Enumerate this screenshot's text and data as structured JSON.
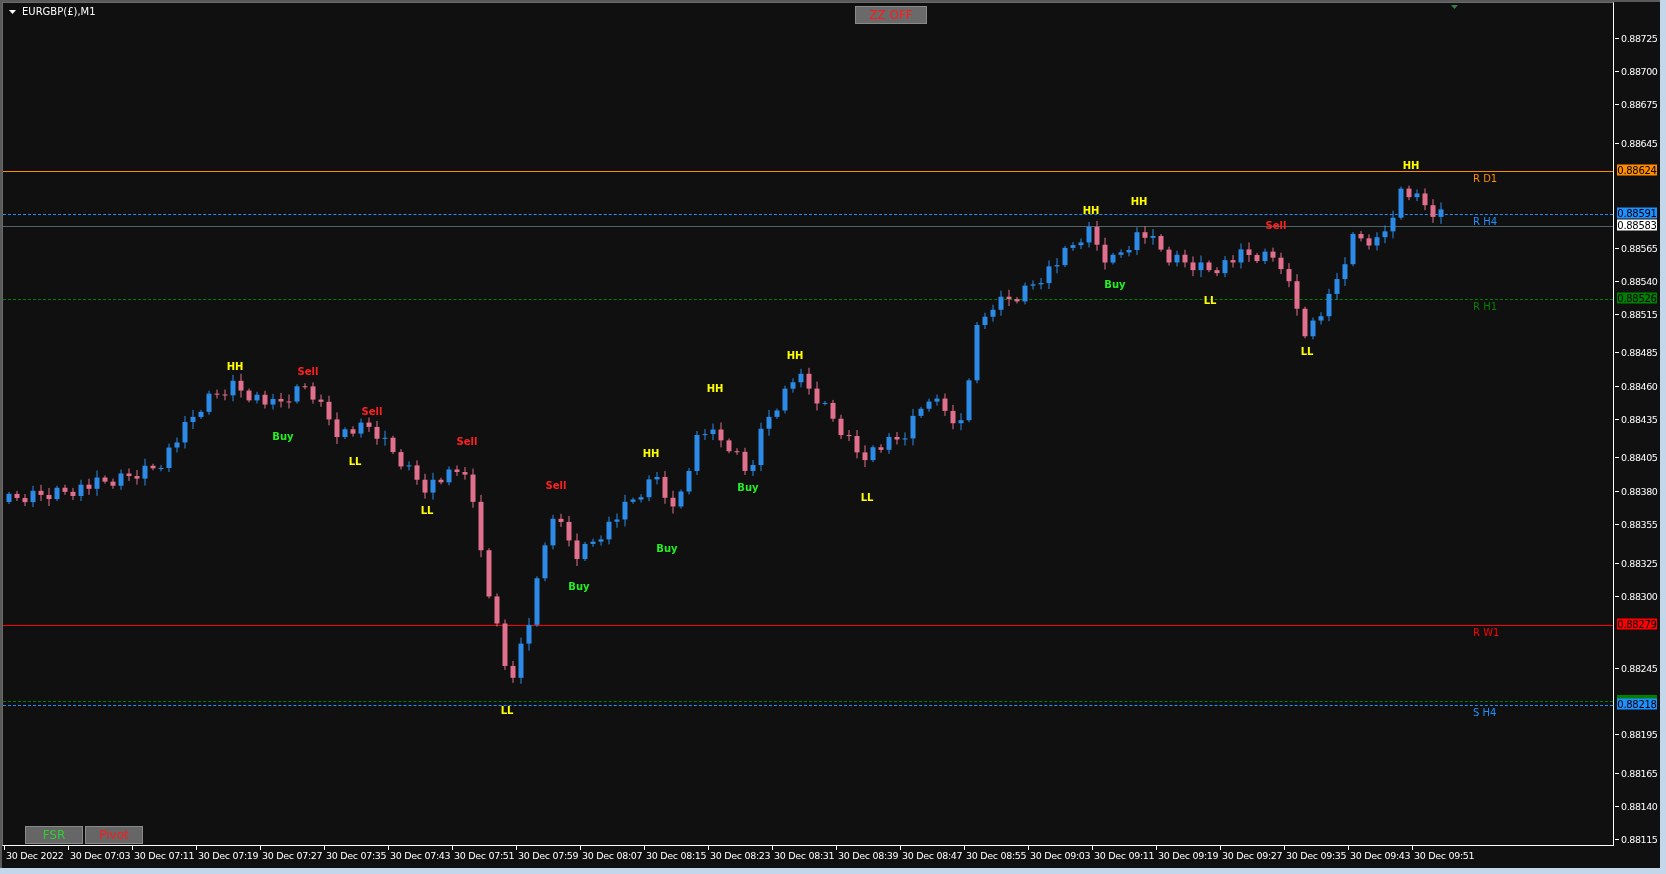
{
  "window": {
    "title": "EURGBP(£),M1"
  },
  "zz_button": {
    "label": "ZZ OFF"
  },
  "panel_buttons": [
    {
      "label": "FSR"
    },
    {
      "label": "Pivot"
    }
  ],
  "levels": [
    {
      "label": "R D1",
      "badge": "0.88624",
      "color": "#ff8c00"
    },
    {
      "label": "R H4",
      "badge": "0.88591",
      "color": "#1e90ff"
    },
    {
      "badge": "0.88583",
      "color": "#ffffff"
    },
    {
      "label": "R H1",
      "badge": "0.88526",
      "color": "#008000"
    },
    {
      "label": "R W1",
      "badge": "0.88279",
      "color": "#ff0000"
    },
    {
      "color": "#008000"
    },
    {
      "label": "S H4",
      "badge": "0.88218",
      "color": "#1e90ff"
    }
  ],
  "price_axis": [
    "0.88725",
    "0.88700",
    "0.88675",
    "0.88645",
    "0.88565",
    "0.88540",
    "0.88515",
    "0.88485",
    "0.88460",
    "0.88435",
    "0.88405",
    "0.88380",
    "0.88355",
    "0.88325",
    "0.88300",
    "0.88245",
    "0.88195",
    "0.88165",
    "0.88140",
    "0.88115"
  ],
  "time_axis": [
    "30 Dec 2022",
    "30 Dec 07:03",
    "30 Dec 07:11",
    "30 Dec 07:19",
    "30 Dec 07:27",
    "30 Dec 07:35",
    "30 Dec 07:43",
    "30 Dec 07:51",
    "30 Dec 07:59",
    "30 Dec 08:07",
    "30 Dec 08:15",
    "30 Dec 08:23",
    "30 Dec 08:31",
    "30 Dec 08:39",
    "30 Dec 08:47",
    "30 Dec 08:55",
    "30 Dec 09:03",
    "30 Dec 09:11",
    "30 Dec 09:19",
    "30 Dec 09:27",
    "30 Dec 09:35",
    "30 Dec 09:43",
    "30 Dec 09:51"
  ],
  "signals": [
    {
      "kind": "hh",
      "text": "HH"
    },
    {
      "kind": "buy",
      "text": "Buy"
    },
    {
      "kind": "sell",
      "text": "Sell"
    },
    {
      "kind": "ll",
      "text": "LL"
    },
    {
      "kind": "sell",
      "text": "Sell"
    },
    {
      "kind": "ll",
      "text": "LL"
    },
    {
      "kind": "sell",
      "text": "Sell"
    },
    {
      "kind": "ll",
      "text": "LL"
    },
    {
      "kind": "sell",
      "text": "Sell"
    },
    {
      "kind": "buy",
      "text": "Buy"
    },
    {
      "kind": "hh",
      "text": "HH"
    },
    {
      "kind": "buy",
      "text": "Buy"
    },
    {
      "kind": "hh",
      "text": "HH"
    },
    {
      "kind": "buy",
      "text": "Buy"
    },
    {
      "kind": "hh",
      "text": "HH"
    },
    {
      "kind": "ll",
      "text": "LL"
    },
    {
      "kind": "hh",
      "text": "HH"
    },
    {
      "kind": "buy",
      "text": "Buy"
    },
    {
      "kind": "hh",
      "text": "HH"
    },
    {
      "kind": "ll",
      "text": "LL"
    },
    {
      "kind": "sell",
      "text": "Sell"
    },
    {
      "kind": "ll",
      "text": "LL"
    },
    {
      "kind": "hh",
      "text": "HH"
    }
  ]
}
